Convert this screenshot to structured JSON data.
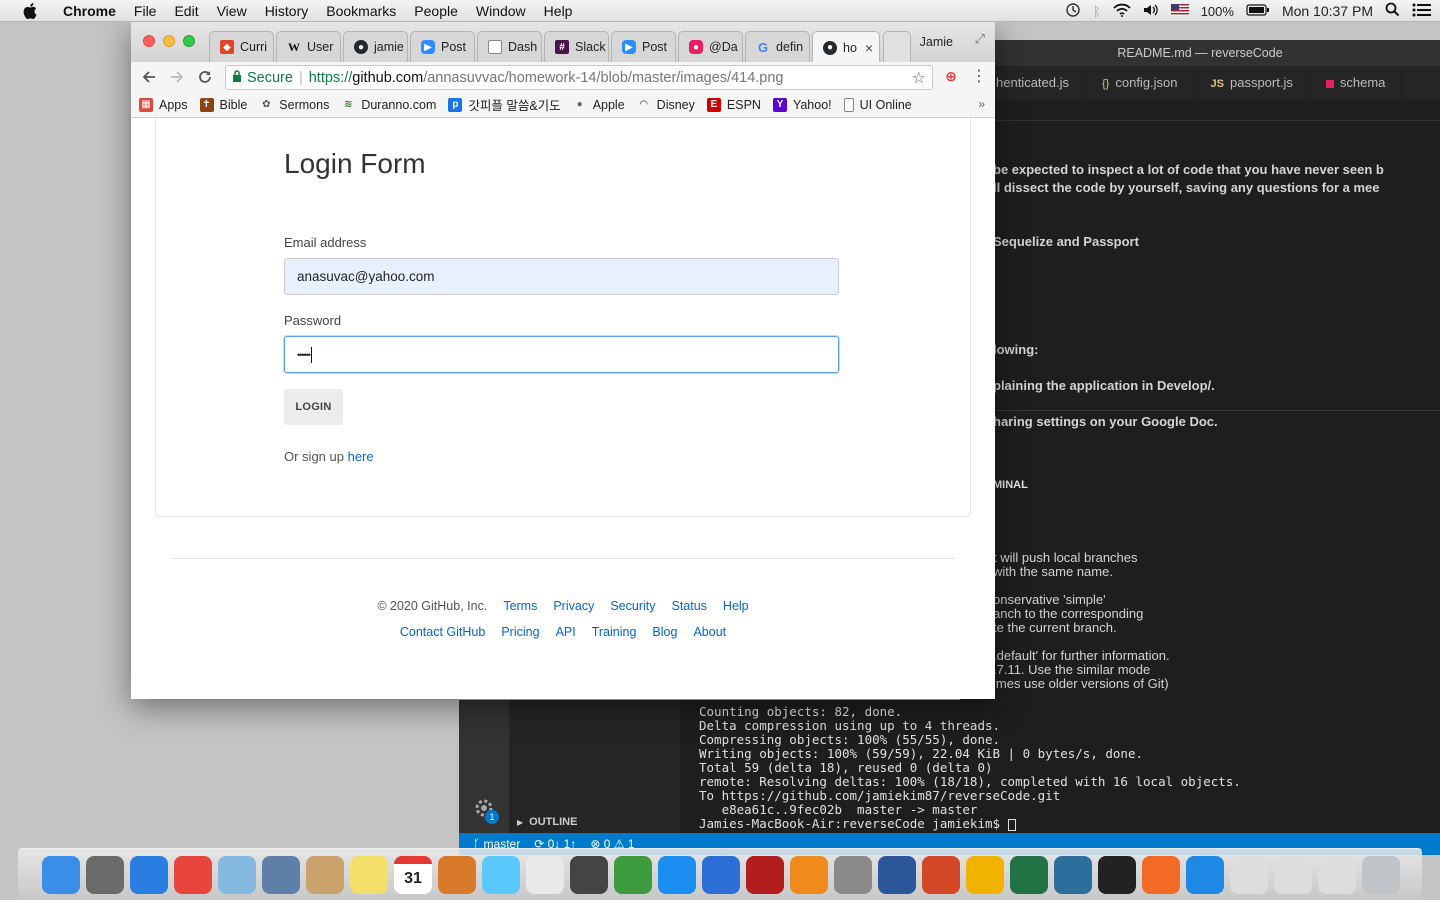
{
  "menubar": {
    "items": [
      "Chrome",
      "File",
      "Edit",
      "View",
      "History",
      "Bookmarks",
      "People",
      "Window",
      "Help"
    ],
    "battery": "100%",
    "clock": "Mon 10:37 PM"
  },
  "editor": {
    "title": "README.md — reverseCode",
    "tabs": [
      {
        "icon": "",
        "label": "henticated.js"
      },
      {
        "icon": "{}",
        "label": "config.json"
      },
      {
        "icon": "JS",
        "label": "passport.js"
      },
      {
        "icon": "",
        "label": "schema"
      }
    ],
    "lines": [
      "be expected to inspect a lot of code that you have never seen b",
      "ll dissect the code by yourself, saving any questions for a mee",
      "Sequelize and Passport",
      "lowing:",
      "plaining the application in Develop/.",
      "haring settings on your Google Doc."
    ],
    "terminal_header": "MINAL",
    "terminal_lines_partial": [
      "t will push local branches",
      "with the same name.",
      "onservative 'simple'",
      "anch to the corresponding",
      "te the current branch.",
      ".default' for further information.",
      ".7.11. Use the similar mode",
      "imes use older versions of Git)"
    ],
    "terminal_lines": [
      "Counting objects: 82, done.",
      "Delta compression using up to 4 threads.",
      "Compressing objects: 100% (55/55), done.",
      "Writing objects: 100% (59/59), 22.04 KiB | 0 bytes/s, done.",
      "Total 59 (delta 18), reused 0 (delta 0)",
      "remote: Resolving deltas: 100% (18/18), completed with 16 local objects.",
      "To https://github.com/jamiekim87/reverseCode.git",
      "   e8ea61c..9fec02b  master -> master",
      "Jamies-MacBook-Air:reverseCode jamiekim$ "
    ],
    "outline_label": "OUTLINE",
    "status": {
      "branch": "master",
      "sync": "0↓ 1↑",
      "problems": "0",
      "warnings": "1"
    },
    "badge": "1"
  },
  "browser": {
    "tabs": [
      {
        "label": "Curri",
        "color": "#e24329"
      },
      {
        "label": "User",
        "color": "#ffffff"
      },
      {
        "label": "jamie",
        "color": "#24292e"
      },
      {
        "label": "Post",
        "color": "#2d8cff"
      },
      {
        "label": "Dash",
        "color": "#ffffff"
      },
      {
        "label": "Slack",
        "color": "#4a154b"
      },
      {
        "label": "Post",
        "color": "#2d8cff"
      },
      {
        "label": "@Da",
        "color": "#e91e63"
      },
      {
        "label": "defin",
        "color": "#ffffff"
      },
      {
        "label": "ho",
        "color": "#24292e"
      }
    ],
    "profile": "Jamie",
    "secure_label": "Secure",
    "url_scheme": "https://",
    "url_host": "github.com",
    "url_path": "/annasuvvac/homework-14/blob/master/images/414.png",
    "bookmarks": [
      {
        "label": "Apps",
        "color": "#e04a3f"
      },
      {
        "label": "Bible",
        "color": "#8b4513"
      },
      {
        "label": "Sermons",
        "color": "#555555"
      },
      {
        "label": "Duranno.com",
        "color": "#2f7d32"
      },
      {
        "label": "갓피플 말씀&기도",
        "color": "#1a73e8"
      },
      {
        "label": "Apple",
        "color": "#666666"
      },
      {
        "label": "Disney",
        "color": "#333333"
      },
      {
        "label": "ESPN",
        "color": "#d00000"
      },
      {
        "label": "Yahoo!",
        "color": "#5f01d1"
      },
      {
        "label": "UI Online",
        "color": "#888888"
      }
    ]
  },
  "page": {
    "title": "Login Form",
    "email_label": "Email address",
    "email_value": "anasuvac@yahoo.com",
    "password_label": "Password",
    "password_value": "••••••",
    "login_button": "LOGIN",
    "signup_prefix": "Or sign up ",
    "signup_link": "here",
    "footer": {
      "copyright": "© 2020 GitHub, Inc.",
      "row1": [
        "Terms",
        "Privacy",
        "Security",
        "Status",
        "Help"
      ],
      "row2": [
        "Contact GitHub",
        "Pricing",
        "API",
        "Training",
        "Blog",
        "About"
      ]
    }
  },
  "dock": {
    "calendar_day": "31",
    "apps": [
      {
        "name": "finder-icon",
        "color": "#3b8ee8"
      },
      {
        "name": "launchpad-icon",
        "color": "#6a6a6a"
      },
      {
        "name": "safari-icon",
        "color": "#2a7de1"
      },
      {
        "name": "chrome-icon",
        "color": "#e8453c"
      },
      {
        "name": "preview-icon",
        "color": "#86b9e0"
      },
      {
        "name": "photos-icon",
        "color": "#5e7fa8"
      },
      {
        "name": "contacts-icon",
        "color": "#c9a36b"
      },
      {
        "name": "notes-icon",
        "color": "#f3df6a"
      },
      {
        "name": "calendar-icon",
        "color": "#ffffff"
      },
      {
        "name": "keynote-charts-icon",
        "color": "#d97a2a"
      },
      {
        "name": "messages-icon",
        "color": "#5ac8fa"
      },
      {
        "name": "textedit-icon",
        "color": "#e9e9e9"
      },
      {
        "name": "photo-booth-icon",
        "color": "#444444"
      },
      {
        "name": "facetime-icon",
        "color": "#3d9a3d"
      },
      {
        "name": "app-store-icon",
        "color": "#1b8cf0"
      },
      {
        "name": "keynote-icon",
        "color": "#2b6fd6"
      },
      {
        "name": "photo-slideshow-icon",
        "color": "#b31d1d"
      },
      {
        "name": "ibooks-icon",
        "color": "#ef8a1d"
      },
      {
        "name": "system-preferences-icon",
        "color": "#8a8a8a"
      },
      {
        "name": "word-icon",
        "color": "#2b579a"
      },
      {
        "name": "powerpoint-icon",
        "color": "#d24726"
      },
      {
        "name": "pages-icon",
        "color": "#f2b200"
      },
      {
        "name": "excel-icon",
        "color": "#217346"
      },
      {
        "name": "mysql-workbench-icon",
        "color": "#2c6e9c"
      },
      {
        "name": "terminal-icon",
        "color": "#222222"
      },
      {
        "name": "sketch-icon",
        "color": "#f26a24"
      },
      {
        "name": "vscode-icon",
        "color": "#1e88e5"
      },
      {
        "name": "window-1-icon",
        "color": "#dddddd"
      },
      {
        "name": "window-2-icon",
        "color": "#dddddd"
      },
      {
        "name": "window-3-icon",
        "color": "#dddddd"
      },
      {
        "name": "trash-icon",
        "color": "#bfc4c8"
      }
    ]
  }
}
